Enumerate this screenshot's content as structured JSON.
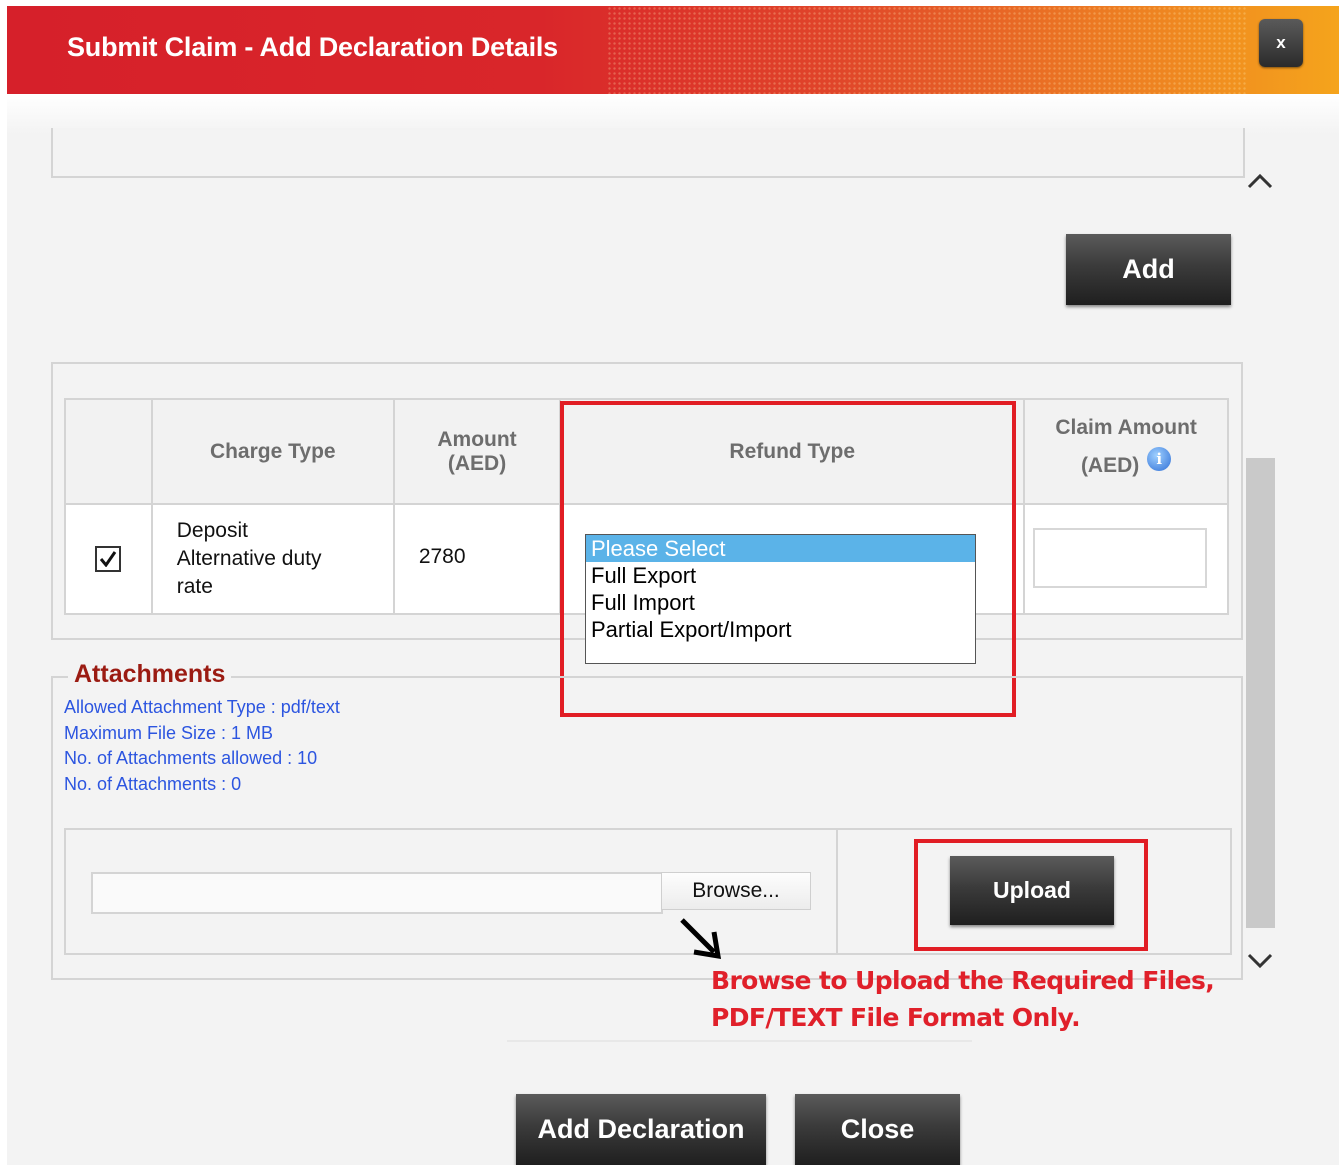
{
  "dialog": {
    "title": "Submit Claim - Add Declaration Details",
    "close_label": "x"
  },
  "toolbar": {
    "add_label": "Add"
  },
  "charges_table": {
    "headers": {
      "charge_type": "Charge Type",
      "amount_line1": "Amount",
      "amount_line2": "(AED)",
      "refund_type": "Refund Type",
      "claim_line1": "Claim Amount",
      "claim_line2": "(AED)"
    },
    "rows": [
      {
        "checked": true,
        "charge_type_lines": [
          "Deposit",
          "Alternative duty",
          "rate"
        ],
        "amount": "2780",
        "refund_type_selected": "Please Select",
        "claim_amount": ""
      }
    ]
  },
  "refund_dropdown": {
    "options": [
      "Please Select",
      "Full Export",
      "Full Import",
      "Partial Export/Import"
    ],
    "selected_index": 0
  },
  "attachments": {
    "legend": "Attachments",
    "info": [
      "Allowed Attachment Type : pdf/text",
      "Maximum File Size : 1 MB",
      "No. of Attachments allowed : 10",
      "No. of Attachments : 0"
    ],
    "file_path_value": "",
    "browse_label": "Browse...",
    "upload_label": "Upload"
  },
  "annotation": {
    "line1": "Browse to Upload the Required Files,",
    "line2": "PDF/TEXT File Format Only."
  },
  "footer": {
    "add_declaration_label": "Add Declaration",
    "close_label": "Close"
  },
  "colors": {
    "annotation_red": "#e11d24",
    "header_gradient_start": "#d6202a",
    "header_gradient_end": "#f5a41c",
    "info_blue": "#2c55e0",
    "legend_maroon": "#9b1b12",
    "selected_option_blue": "#5bb3e8"
  }
}
